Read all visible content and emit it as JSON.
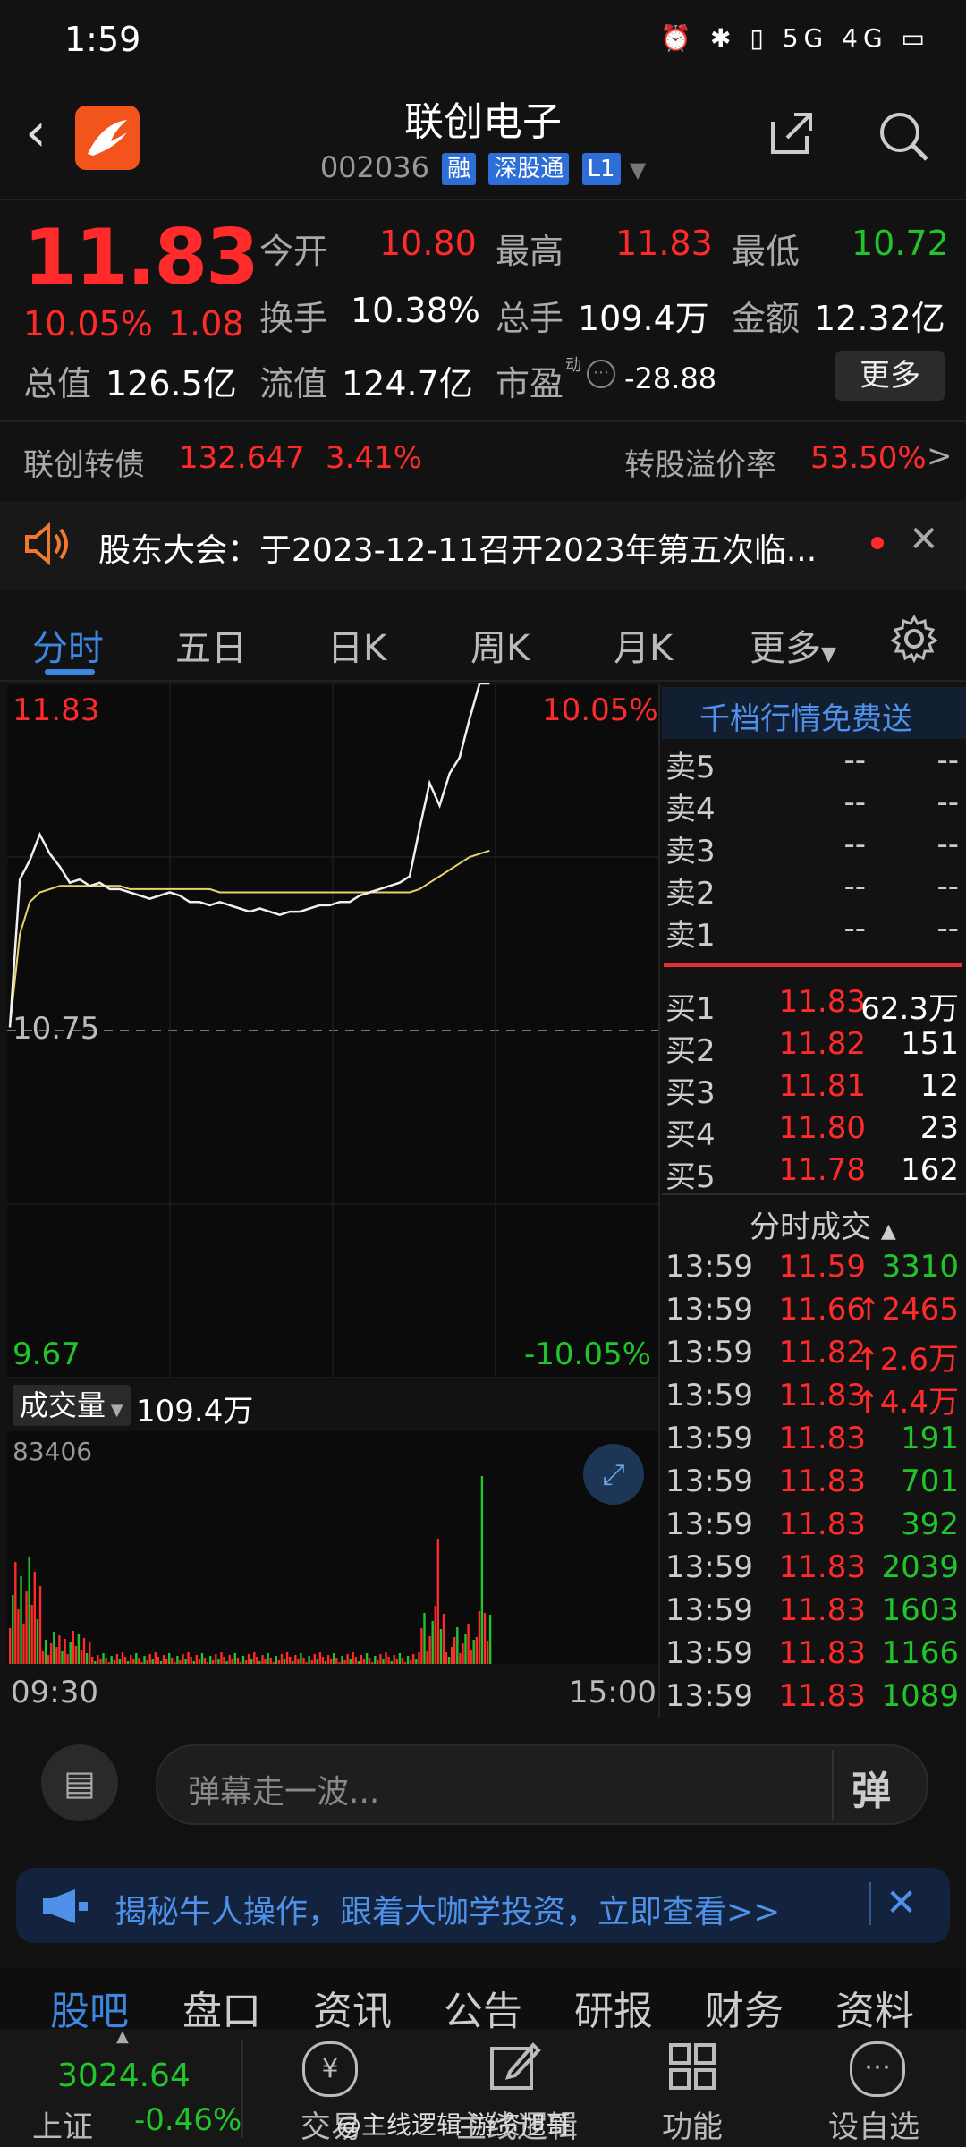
{
  "status_bar": {
    "time": "1:59",
    "icons": "⏰ ✱ ▯ 5G 4G ▭"
  },
  "header": {
    "back_icon": "back-chevron-icon",
    "title": "联创电子",
    "code": "002036",
    "tags": [
      "融",
      "深股通",
      "L1"
    ]
  },
  "quote": {
    "price": "11.83",
    "pct": "10.05%",
    "change": "1.08",
    "open_label": "今开",
    "open": "10.80",
    "high_label": "最高",
    "high": "11.83",
    "low_label": "最低",
    "low": "10.72",
    "turnover_label": "换手",
    "turnover": "10.38%",
    "volume_label": "总手",
    "volume": "109.4万",
    "amount_label": "金额",
    "amount": "12.32亿",
    "mcap_label": "总值",
    "mcap": "126.5亿",
    "float_label": "流值",
    "float_cap": "124.7亿",
    "pe_label": "市盈",
    "pe_sup": "动",
    "pe": "-28.88",
    "more": "更多"
  },
  "convert_bond": {
    "name": "联创转债",
    "price": "132.647",
    "pct": "3.41%",
    "premium_label": "转股溢价率",
    "premium": "53.50%",
    "arrow": ">"
  },
  "notice": {
    "text": "股东大会：于2023-12-11召开2023年第五次临...",
    "icon": "speaker-icon"
  },
  "tabs": [
    "分时",
    "五日",
    "日K",
    "周K",
    "月K",
    "更多"
  ],
  "chart": {
    "high_price": "11.83",
    "high_pct": "10.05%",
    "mid_price": "10.75",
    "low_price": "9.67",
    "low_pct": "-10.05%",
    "volume_label": "成交量",
    "volume_total": "109.4万",
    "volume_max": "83406",
    "time_start": "09:30",
    "time_end": "15:00"
  },
  "chart_data": {
    "type": "line",
    "x": [
      0,
      5,
      10,
      15,
      20,
      25,
      30,
      35,
      40,
      45,
      50,
      55,
      60,
      65,
      70,
      75,
      80,
      85,
      90,
      95,
      100,
      105,
      110,
      115,
      120,
      125,
      130,
      135,
      140,
      145,
      150,
      155,
      160,
      165,
      170,
      175,
      180,
      185,
      190,
      195,
      200,
      205,
      210,
      215,
      220,
      225,
      230,
      235,
      240
    ],
    "series": [
      {
        "values": [
          10.76,
          11.22,
          11.28,
          11.36,
          11.3,
          11.26,
          11.21,
          11.22,
          11.2,
          11.21,
          11.19,
          11.19,
          11.18,
          11.17,
          11.16,
          11.17,
          11.18,
          11.17,
          11.15,
          11.15,
          11.14,
          11.15,
          11.14,
          11.13,
          11.12,
          11.13,
          11.12,
          11.11,
          11.12,
          11.12,
          11.13,
          11.14,
          11.14,
          11.15,
          11.15,
          11.17,
          11.18,
          11.19,
          11.2,
          11.21,
          11.23,
          11.38,
          11.52,
          11.45,
          11.55,
          11.6,
          11.72,
          11.83,
          11.83
        ]
      },
      {
        "values": [
          10.76,
          11.05,
          11.15,
          11.18,
          11.19,
          11.2,
          11.2,
          11.2,
          11.2,
          11.2,
          11.2,
          11.2,
          11.19,
          11.19,
          11.19,
          11.19,
          11.19,
          11.19,
          11.19,
          11.19,
          11.19,
          11.18,
          11.18,
          11.18,
          11.18,
          11.18,
          11.18,
          11.18,
          11.18,
          11.18,
          11.18,
          11.18,
          11.18,
          11.18,
          11.18,
          11.18,
          11.18,
          11.18,
          11.18,
          11.18,
          11.18,
          11.19,
          11.21,
          11.23,
          11.25,
          11.27,
          11.29,
          11.3,
          11.31
        ]
      }
    ],
    "ylim": [
      9.67,
      11.83
    ]
  },
  "order_book": {
    "banner": "千档行情免费送",
    "asks": [
      {
        "label": "卖5",
        "price": "--",
        "vol": "--"
      },
      {
        "label": "卖4",
        "price": "--",
        "vol": "--"
      },
      {
        "label": "卖3",
        "price": "--",
        "vol": "--"
      },
      {
        "label": "卖2",
        "price": "--",
        "vol": "--"
      },
      {
        "label": "卖1",
        "price": "--",
        "vol": "--"
      }
    ],
    "bids": [
      {
        "label": "买1",
        "price": "11.83",
        "vol": "62.3万"
      },
      {
        "label": "买2",
        "price": "11.82",
        "vol": "151"
      },
      {
        "label": "买3",
        "price": "11.81",
        "vol": "12"
      },
      {
        "label": "买4",
        "price": "11.80",
        "vol": "23"
      },
      {
        "label": "买5",
        "price": "11.78",
        "vol": "162"
      }
    ],
    "trades_header": "分时成交",
    "trades": [
      {
        "time": "13:59",
        "price": "11.59",
        "vol": "3310",
        "up": false,
        "vcolor": "#21c52b"
      },
      {
        "time": "13:59",
        "price": "11.66",
        "vol": "↑2465",
        "up": true,
        "vcolor": "#ff2a2a"
      },
      {
        "time": "13:59",
        "price": "11.82",
        "vol": "↑2.6万",
        "up": true,
        "vcolor": "#ff2a2a"
      },
      {
        "time": "13:59",
        "price": "11.83",
        "vol": "↑4.4万",
        "up": true,
        "vcolor": "#ff2a2a"
      },
      {
        "time": "13:59",
        "price": "11.83",
        "vol": "191",
        "up": false,
        "vcolor": "#21c52b"
      },
      {
        "time": "13:59",
        "price": "11.83",
        "vol": "701",
        "up": false,
        "vcolor": "#21c52b"
      },
      {
        "time": "13:59",
        "price": "11.83",
        "vol": "392",
        "up": false,
        "vcolor": "#21c52b"
      },
      {
        "time": "13:59",
        "price": "11.83",
        "vol": "2039",
        "up": false,
        "vcolor": "#21c52b"
      },
      {
        "time": "13:59",
        "price": "11.83",
        "vol": "1603",
        "up": false,
        "vcolor": "#21c52b"
      },
      {
        "time": "13:59",
        "price": "11.83",
        "vol": "1166",
        "up": false,
        "vcolor": "#21c52b"
      },
      {
        "time": "13:59",
        "price": "11.83",
        "vol": "1089",
        "up": false,
        "vcolor": "#21c52b"
      }
    ]
  },
  "danmu": {
    "placeholder": "弹幕走一波...",
    "button": "弹"
  },
  "banner": {
    "text": "揭秘牛人操作，跟着大咖学投资，立即查看>>"
  },
  "bottom_tabs": [
    "股吧",
    "盘口",
    "资讯",
    "公告",
    "研报",
    "财务",
    "资料"
  ],
  "navbar": {
    "index_value": "3024.64",
    "index_name": "上证",
    "index_pct": "-0.46%",
    "items": [
      "交易",
      "主线逻辑",
      "功能",
      "设自选"
    ],
    "watermark": "@主线逻辑-游资旭哥"
  },
  "colors": {
    "up": "#ff2a2a",
    "down": "#21c52b",
    "accent": "#2d7bd8",
    "avg_line": "#e8d36a"
  }
}
